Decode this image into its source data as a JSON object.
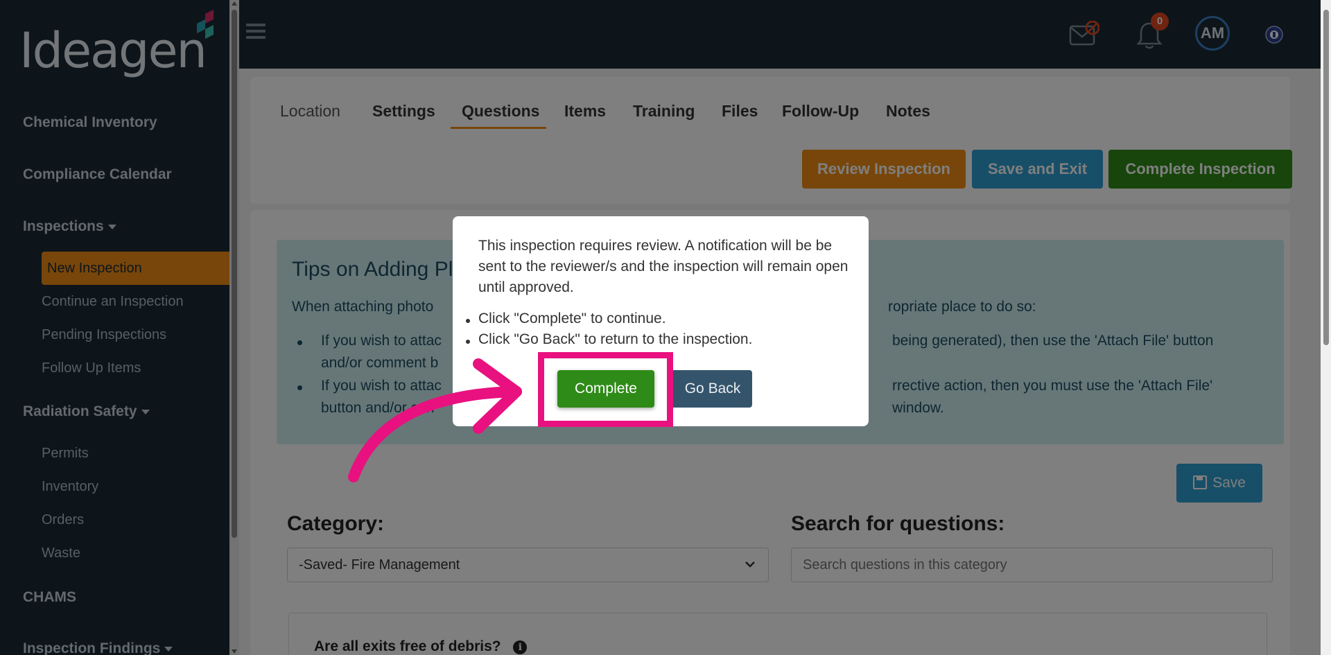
{
  "sidebar": {
    "logo_text": "Ideagen",
    "items": [
      {
        "label": "Chemical Inventory"
      },
      {
        "label": "Compliance Calendar"
      },
      {
        "label": "Inspections"
      },
      {
        "label": "New Inspection"
      },
      {
        "label": "Continue an Inspection"
      },
      {
        "label": "Pending Inspections"
      },
      {
        "label": "Follow Up Items"
      },
      {
        "label": "Radiation Safety"
      },
      {
        "label": "Permits"
      },
      {
        "label": "Inventory"
      },
      {
        "label": "Orders"
      },
      {
        "label": "Waste"
      },
      {
        "label": "CHAMS"
      },
      {
        "label": "Inspection Findings"
      }
    ]
  },
  "header": {
    "notification_count": "0",
    "avatar_initials": "AM"
  },
  "tabs": [
    "Location",
    "Settings",
    "Questions",
    "Items",
    "Training",
    "Files",
    "Follow-Up",
    "Notes"
  ],
  "actions": {
    "review": "Review Inspection",
    "save_exit": "Save and Exit",
    "complete": "Complete Inspection"
  },
  "tips": {
    "title": "Tips on Adding Pl",
    "intro": "When attaching photo",
    "intro_right": "ropriate place to do so:",
    "item1_line1_left": "If you wish to attac",
    "item1_line1_right": "being generated), then use the 'Attach File' button",
    "item1_line2": "and/or comment b",
    "item2_line1_left": "If you wish to attac",
    "item2_line1_right": "rrective action, then you must use the 'Attach File'",
    "item2_line2_left": "button and/or con",
    "item2_line2_right": "window."
  },
  "form": {
    "save_label": "Save",
    "category_label": "Category:",
    "category_value": "-Saved- Fire Management",
    "search_label": "Search for questions:",
    "search_placeholder": "Search questions in this category",
    "question": "Are all exits free of debris?"
  },
  "modal": {
    "message": "This inspection requires review. A notification will be be sent to the reviewer/s and the inspection will remain open until approved.",
    "item1": "Click \"Complete\" to continue.",
    "item2": "Click \"Go Back\" to return to the inspection.",
    "complete_label": "Complete",
    "goback_label": "Go Back"
  },
  "colors": {
    "sidebar_bg": "#1b2a35",
    "accent_orange": "#f08d14",
    "blue": "#2f9fd0",
    "green": "#2e8b17",
    "highlight_pink": "#e8117f"
  }
}
